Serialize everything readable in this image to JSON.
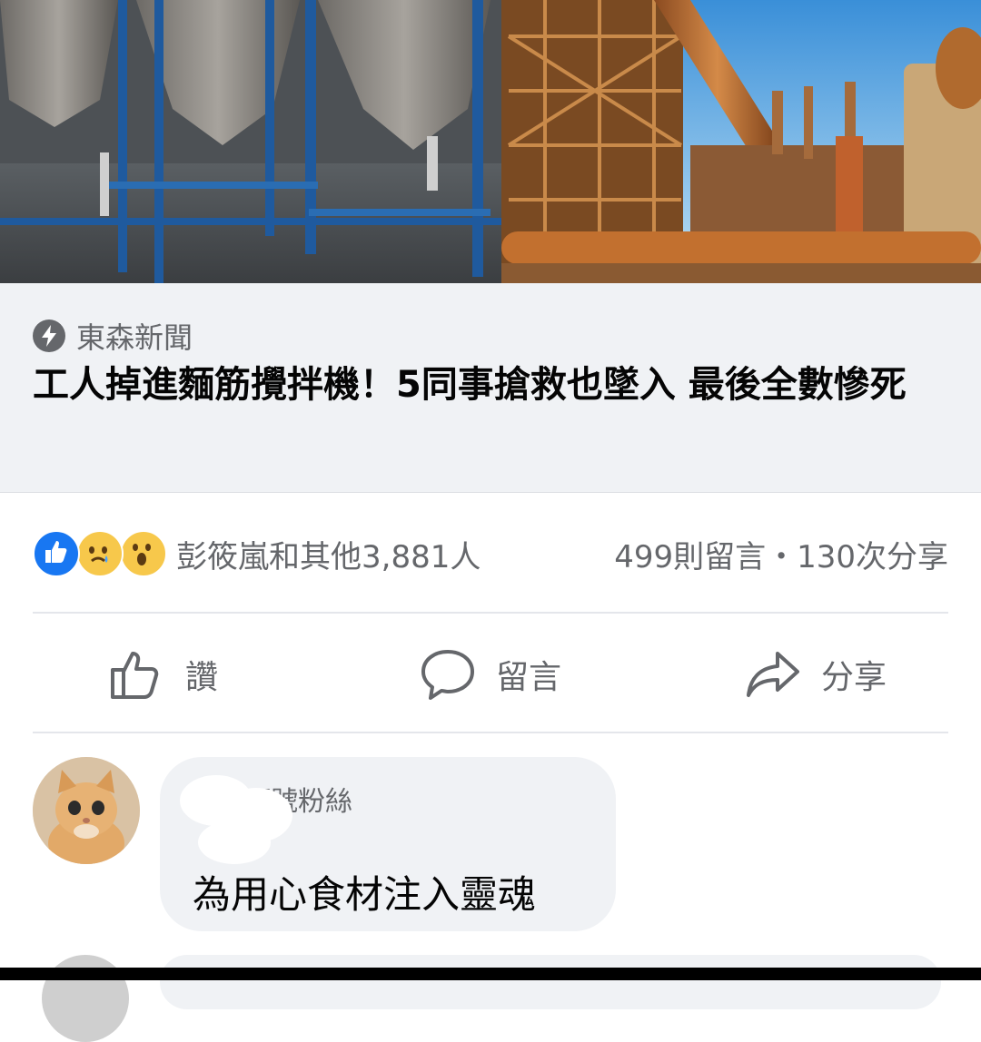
{
  "link_preview": {
    "source_icon": "lightning-bolt-icon",
    "source": "東森新聞",
    "headline": "工人掉進麵筋攪拌機！5同事搶救也墜入 最後全數慘死"
  },
  "reactions": {
    "icons": [
      "like",
      "sad",
      "wow"
    ],
    "reactors_text": "彭筱嵐和其他3,881人",
    "counts_text": "499則留言・130次分享"
  },
  "actions": {
    "like_label": "讚",
    "comment_label": "留言",
    "share_label": "分享"
  },
  "comment": {
    "badge": "頭號粉絲",
    "text": "為用心食材注入靈魂"
  },
  "colors": {
    "accent": "#1877f2",
    "secondary_text": "#65676b",
    "card_bg": "#f0f2f5"
  }
}
